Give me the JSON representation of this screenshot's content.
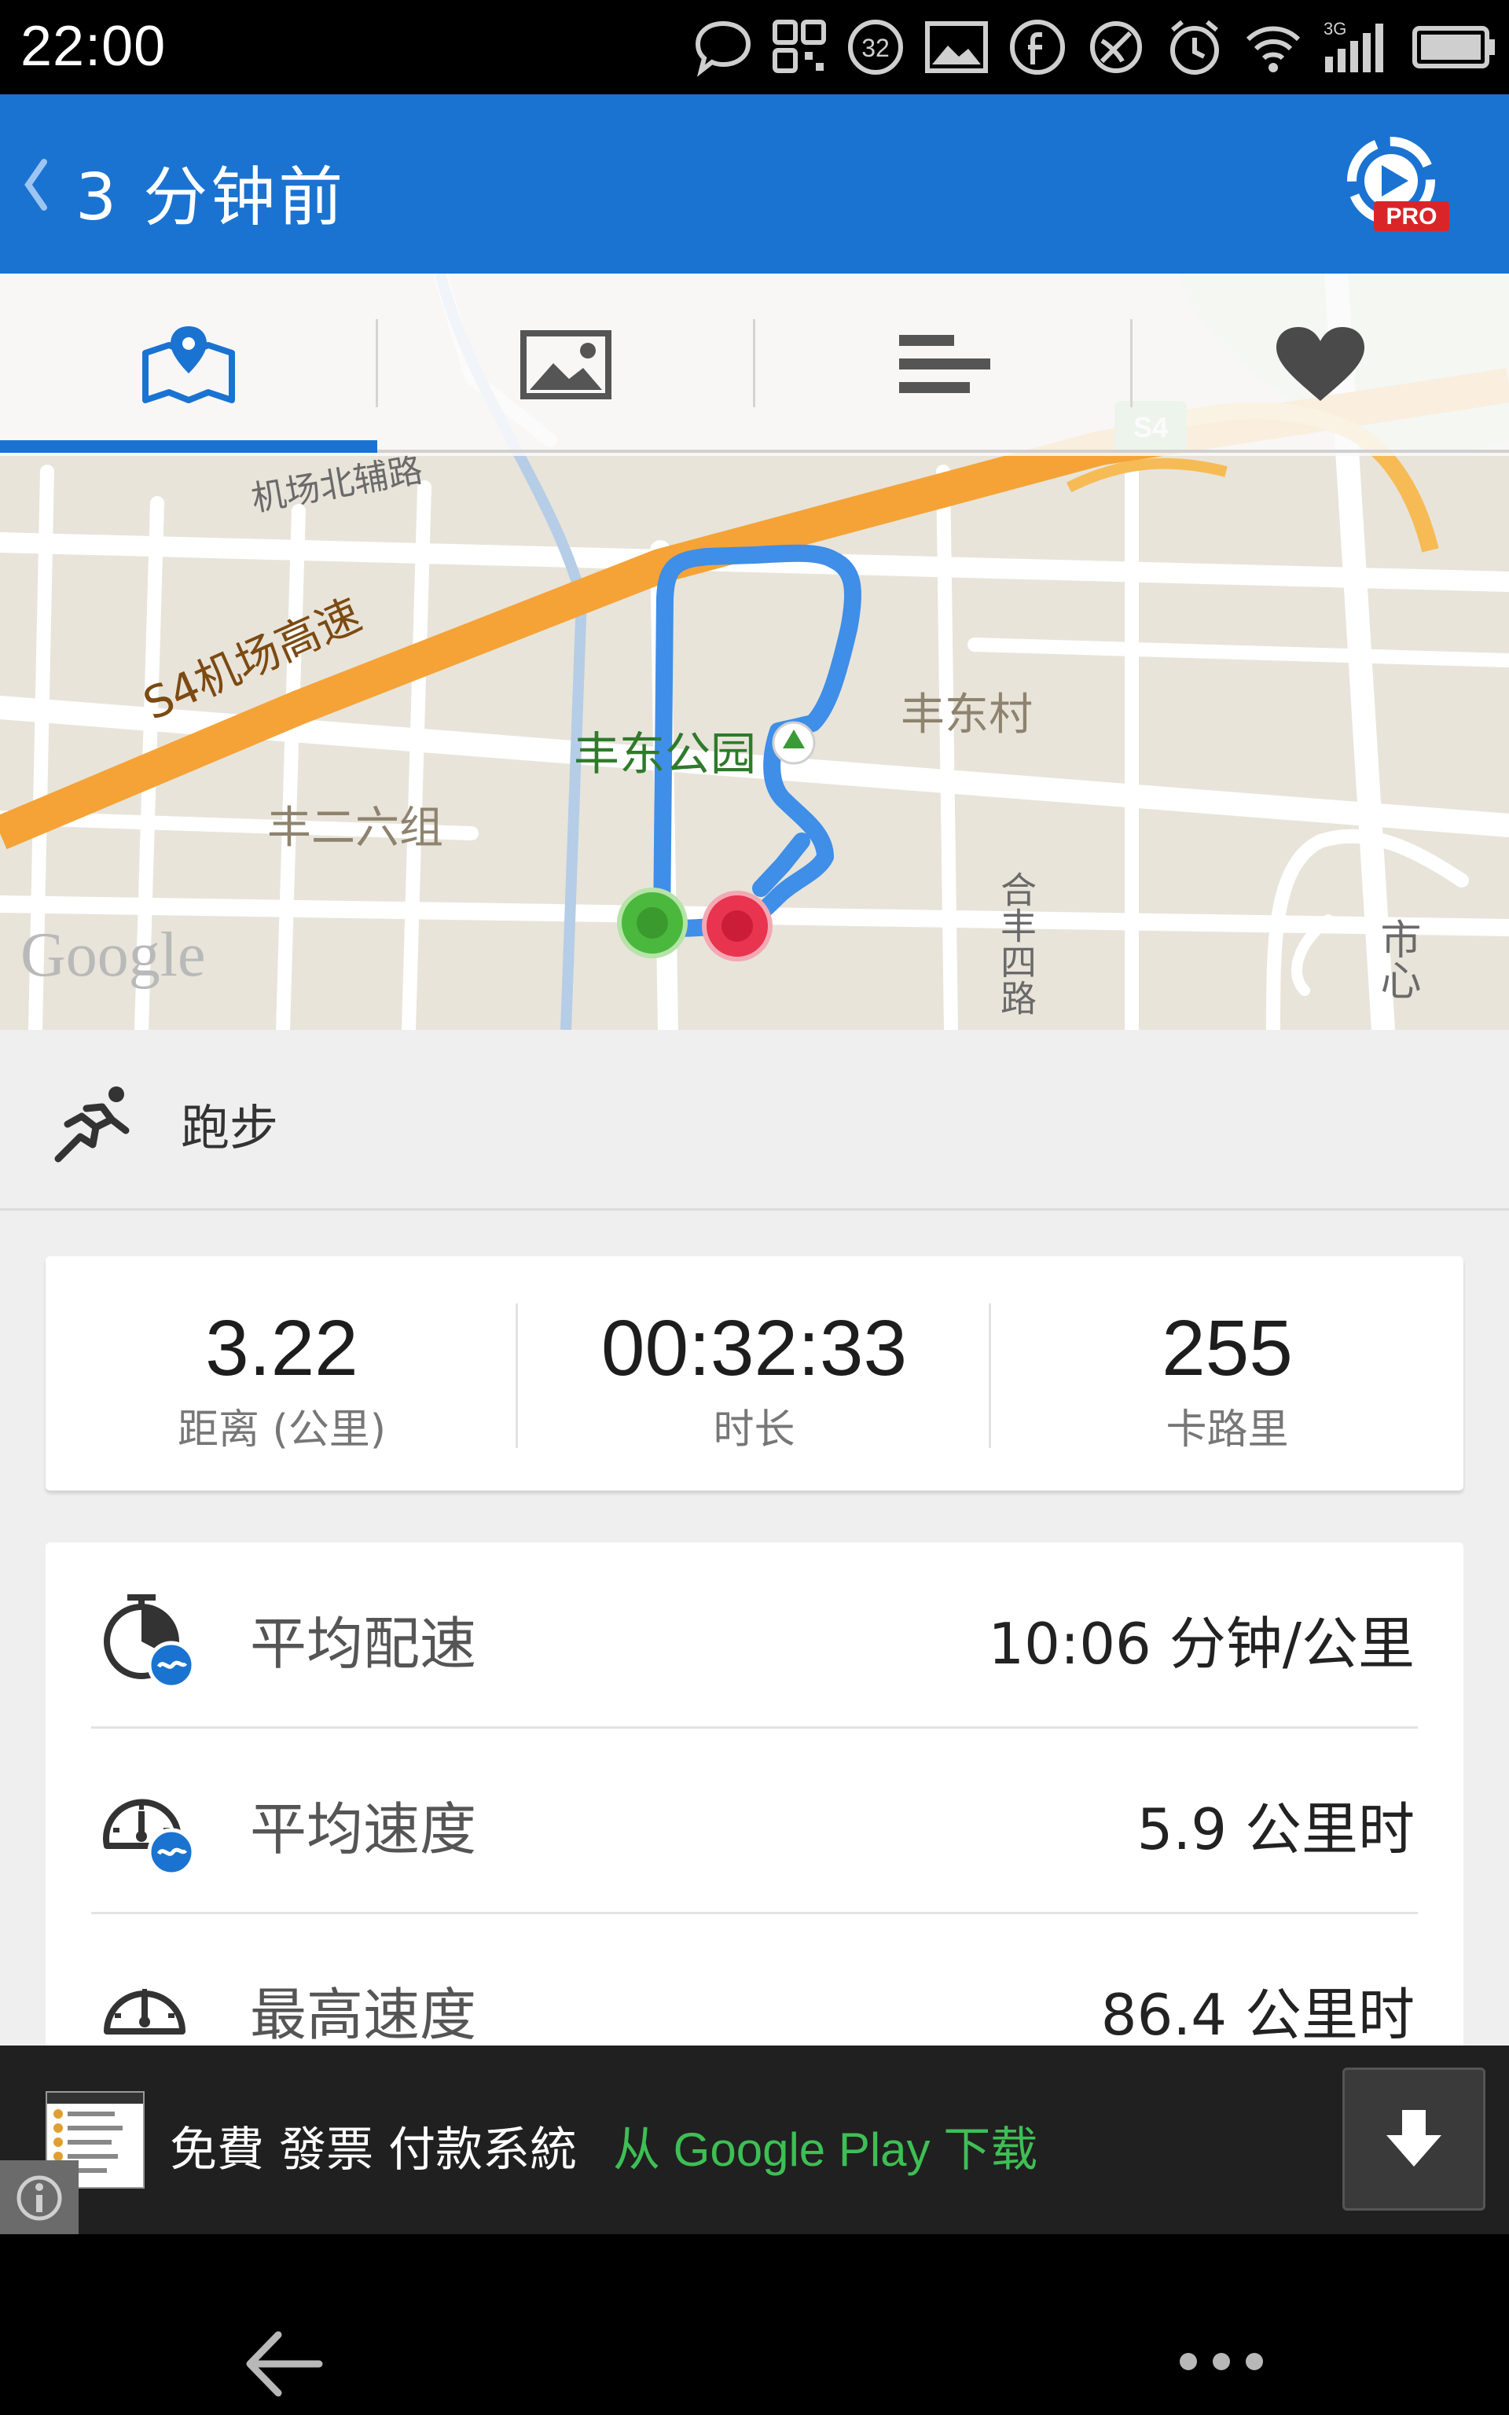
{
  "status_bar": {
    "time": "22:00",
    "icons": [
      "chat-bubble-icon",
      "qr-icon",
      "notification-32-icon",
      "image-icon",
      "facebook-icon",
      "radar-icon",
      "alarm-icon",
      "wifi-icon",
      "signal-3g-icon",
      "battery-icon"
    ],
    "notification_count": "32",
    "network_label": "3G"
  },
  "header": {
    "title": "3 分钟前",
    "pro_badge": "PRO"
  },
  "tabs": [
    {
      "name": "map",
      "icon": "map-pin-icon",
      "active": true
    },
    {
      "name": "photos",
      "icon": "image-icon",
      "active": false
    },
    {
      "name": "splits",
      "icon": "bars-icon",
      "active": false
    },
    {
      "name": "heart",
      "icon": "heart-icon",
      "active": false
    }
  ],
  "map": {
    "labels": {
      "road_north": "机场北辅路",
      "expressway": "S4机场高速",
      "highway_shield": "S4",
      "park": "丰东公园",
      "village_east": "丰东村",
      "village_west": "丰二六组",
      "road_south": "合丰四路",
      "road_right": "市心",
      "provider": "Google"
    },
    "colors": {
      "route": "#3f8ee8",
      "start": "#4ab83c",
      "end": "#e8344e",
      "expressway": "#f5a337"
    }
  },
  "activity": {
    "type": "跑步",
    "icon": "runner-icon"
  },
  "summary": [
    {
      "value": "3.22",
      "label": "距离 (公里)"
    },
    {
      "value": "00:32:33",
      "label": "时长"
    },
    {
      "value": "255",
      "label": "卡路里"
    }
  ],
  "details": [
    {
      "label": "平均配速",
      "value": "10:06 分钟/公里",
      "icon": "pace-clock-icon"
    },
    {
      "label": "平均速度",
      "value": "5.9 公里时",
      "icon": "speedometer-avg-icon"
    },
    {
      "label": "最高速度",
      "value": "86.4 公里时",
      "icon": "speedometer-icon"
    }
  ],
  "ad": {
    "text": "免費 發票 付款系統",
    "cta": "从 Google Play 下载"
  },
  "accent_color": "#1a73d1"
}
